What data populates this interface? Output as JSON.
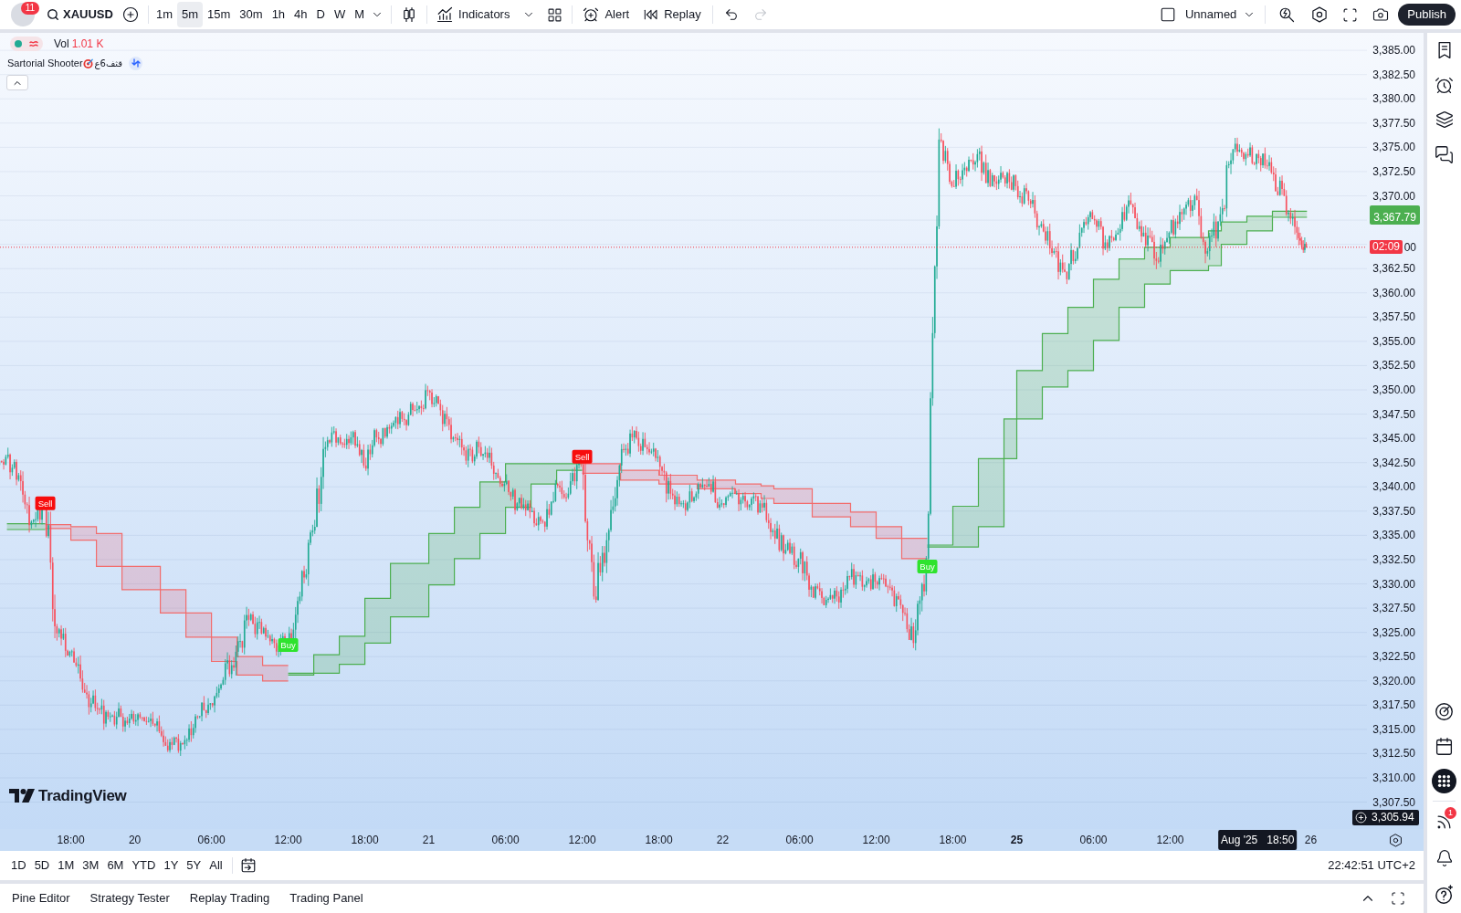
{
  "toolbar": {
    "notification_count": "11",
    "symbol": "XAUUSD",
    "intervals": [
      {
        "label": "1m",
        "selected": false
      },
      {
        "label": "5m",
        "selected": true
      },
      {
        "label": "15m",
        "selected": false
      },
      {
        "label": "30m",
        "selected": false
      },
      {
        "label": "1h",
        "selected": false
      },
      {
        "label": "4h",
        "selected": false
      },
      {
        "label": "D",
        "selected": false
      },
      {
        "label": "W",
        "selected": false
      },
      {
        "label": "M",
        "selected": false
      }
    ],
    "indicators_button": "Indicators",
    "alert_button": "Alert",
    "replay_button": "Replay",
    "undo": {
      "disabled": false
    },
    "redo": {
      "disabled": true
    },
    "layout_name": "Unnamed",
    "publish_button": "Publish"
  },
  "legend": {
    "volume_label": "Vol",
    "volume_value": "1.01 K",
    "indicator_name": "Sartorial Shooter",
    "indicator_suffix": "قثف6ع"
  },
  "chart": {
    "signals": [
      {
        "kind": "sell",
        "text": "Sell"
      },
      {
        "kind": "buy",
        "text": "Buy"
      },
      {
        "kind": "sell",
        "text": "Sell"
      },
      {
        "kind": "buy",
        "text": "Buy"
      }
    ],
    "logo_text": "TradingView"
  },
  "price_axis": {
    "labels": [
      "3,385.00",
      "3,382.50",
      "3,380.00",
      "3,377.50",
      "3,375.00",
      "3,372.50",
      "3,370.00",
      "3,362.50",
      "3,360.00",
      "3,357.50",
      "3,355.00",
      "3,352.50",
      "3,350.00",
      "3,347.50",
      "3,345.00",
      "3,342.50",
      "3,340.00",
      "3,337.50",
      "3,335.00",
      "3,332.50",
      "3,330.00",
      "3,327.50",
      "3,325.00",
      "3,322.50",
      "3,320.00",
      "3,317.50",
      "3,315.00",
      "3,312.50",
      "3,310.00",
      "3,307.50"
    ],
    "partial_label": "00",
    "indicator_tag": "3,367.79",
    "countdown_tag": "02:09",
    "crosshair_tag": "3,305.94"
  },
  "time_axis": {
    "labels": [
      {
        "text": "18:00",
        "bold": false
      },
      {
        "text": "20",
        "bold": false
      },
      {
        "text": "06:00",
        "bold": false
      },
      {
        "text": "12:00",
        "bold": false
      },
      {
        "text": "18:00",
        "bold": false
      },
      {
        "text": "21",
        "bold": false
      },
      {
        "text": "06:00",
        "bold": false
      },
      {
        "text": "12:00",
        "bold": false
      },
      {
        "text": "18:00",
        "bold": false
      },
      {
        "text": "22",
        "bold": false
      },
      {
        "text": "06:00",
        "bold": false
      },
      {
        "text": "12:00",
        "bold": false
      },
      {
        "text": "18:00",
        "bold": false
      },
      {
        "text": "25",
        "bold": true
      },
      {
        "text": "06:00",
        "bold": false
      },
      {
        "text": "12:00",
        "bold": false
      },
      {
        "text": "26",
        "bold": false
      }
    ],
    "crosshair_tag": "Aug '25   18:50"
  },
  "range_buttons": [
    "1D",
    "5D",
    "1M",
    "3M",
    "6M",
    "YTD",
    "1Y",
    "5Y",
    "All"
  ],
  "clock": "22:42:51 UTC+2",
  "bottom_tabs": [
    "Pine Editor",
    "Strategy Tester",
    "Replay Trading",
    "Trading Panel"
  ],
  "right_sidebar": {
    "feed_badge": "1"
  }
}
